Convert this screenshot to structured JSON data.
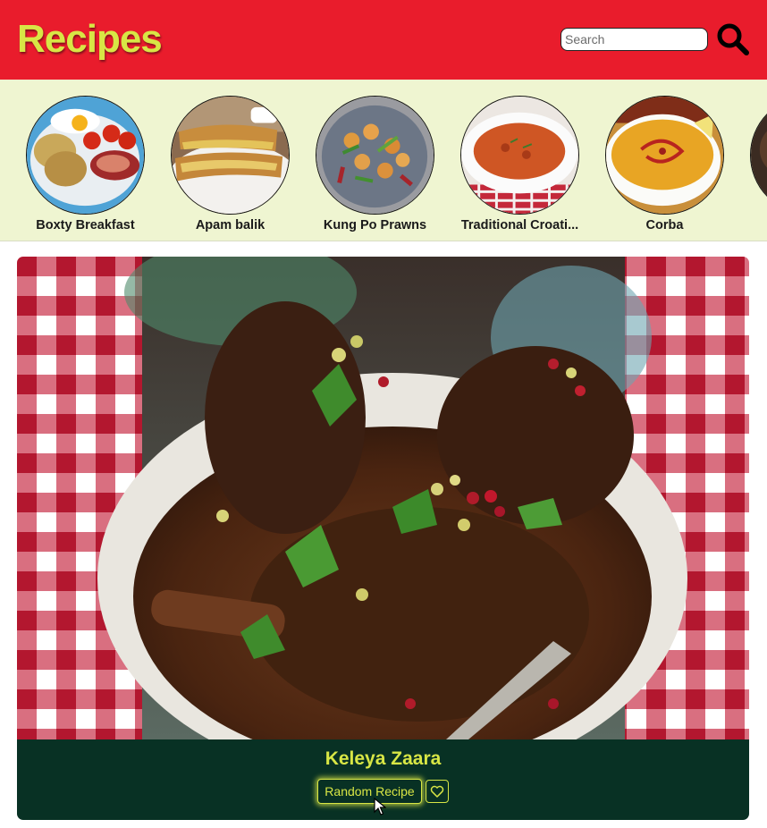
{
  "header": {
    "title": "Recipes",
    "search_placeholder": "Search",
    "search_icon": "search-icon",
    "background": "#e91c2c",
    "accent": "#d8e645"
  },
  "categories": [
    {
      "label": "Boxty Breakfast"
    },
    {
      "label": "Apam balik"
    },
    {
      "label": "Kung Po Prawns"
    },
    {
      "label": "Traditional Croati..."
    },
    {
      "label": "Corba"
    }
  ],
  "featured": {
    "meal_name": "Keleya Zaara",
    "random_button_label": "Random Recipe",
    "favorite_icon": "heart-icon",
    "footer_background": "#083124"
  }
}
